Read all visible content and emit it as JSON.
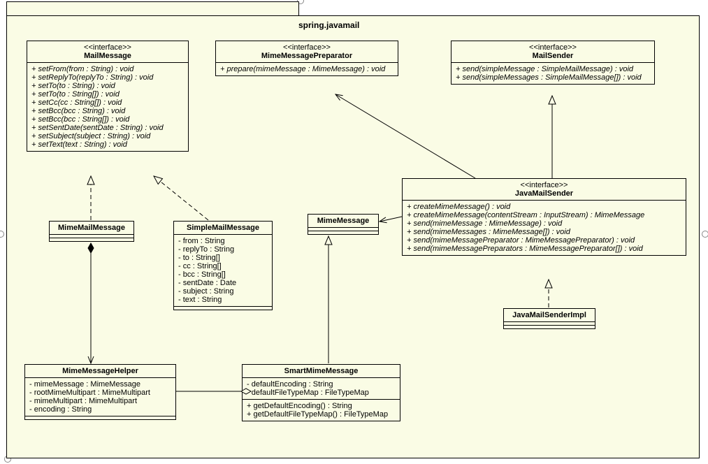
{
  "package": {
    "name": "spring.javamail"
  },
  "mailMessage": {
    "stereo": "<<interface>>",
    "name": "MailMessage",
    "ops": [
      "+ setFrom(from : String) : void",
      "+ setReplyTo(replyTo : String) : void",
      "+ setTo(to : String) : void",
      "+ setTo(to : String[]) : void",
      "+ setCc(cc : String[]) : void",
      "+ setBcc(bcc : String) : void",
      "+ setBcc(bcc : String[]) : void",
      "+ setSentDate(sentDate : String) : void",
      "+ setSubject(subject : String) : void",
      "+ setText(text : String) : void"
    ]
  },
  "mimeMessagePreparator": {
    "stereo": "<<interface>>",
    "name": "MimeMessagePreparator",
    "ops": [
      "+ prepare(mimeMessage : MimeMessage) : void"
    ]
  },
  "mailSender": {
    "stereo": "<<interface>>",
    "name": "MailSender",
    "ops": [
      "+ send(simpleMessage : SimpleMailMessage) : void",
      "+ send(simpleMessages : SimpleMailMessage[]) : void"
    ]
  },
  "mimeMailMessage": {
    "name": "MimeMailMessage"
  },
  "simpleMailMessage": {
    "name": "SimpleMailMessage",
    "attrs": [
      "- from : String",
      "- replyTo : String",
      "- to : String[]",
      "- cc : String[]",
      "- bcc : String[]",
      "- sentDate : Date",
      "- subject : String",
      "- text : String"
    ]
  },
  "mimeMessage": {
    "name": "MimeMessage"
  },
  "javaMailSender": {
    "stereo": "<<interface>>",
    "name": "JavaMailSender",
    "ops": [
      "+ createMimeMessage() : void",
      "+ createMimeMessage(contentStream : InputStream) : MimeMessage",
      "+ send(mimeMessage : MimeMessage) : void",
      "+ send(mimeMessages : MimeMessage[]) : void",
      "+ send(mimeMessagePreparator : MimeMessagePreparator) : void",
      "+ send(mimeMessagePreparators : MimeMessagePreparator[]) : void"
    ]
  },
  "javaMailSenderImpl": {
    "name": "JavaMailSenderImpl"
  },
  "mimeMessageHelper": {
    "name": "MimeMessageHelper",
    "attrs": [
      "- mimeMessage : MimeMessage",
      "- rootMimeMultipart : MimeMultipart",
      "- mimeMultipart : MimeMultipart",
      "- encoding : String"
    ]
  },
  "smartMimeMessage": {
    "name": "SmartMimeMessage",
    "attrs": [
      "- defaultEncoding : String",
      "- defaultFileTypeMap : FileTypeMap"
    ],
    "ops": [
      "+ getDefaultEncoding() : String",
      "+ getDefaultFileTypeMap() : FileTypeMap"
    ]
  }
}
